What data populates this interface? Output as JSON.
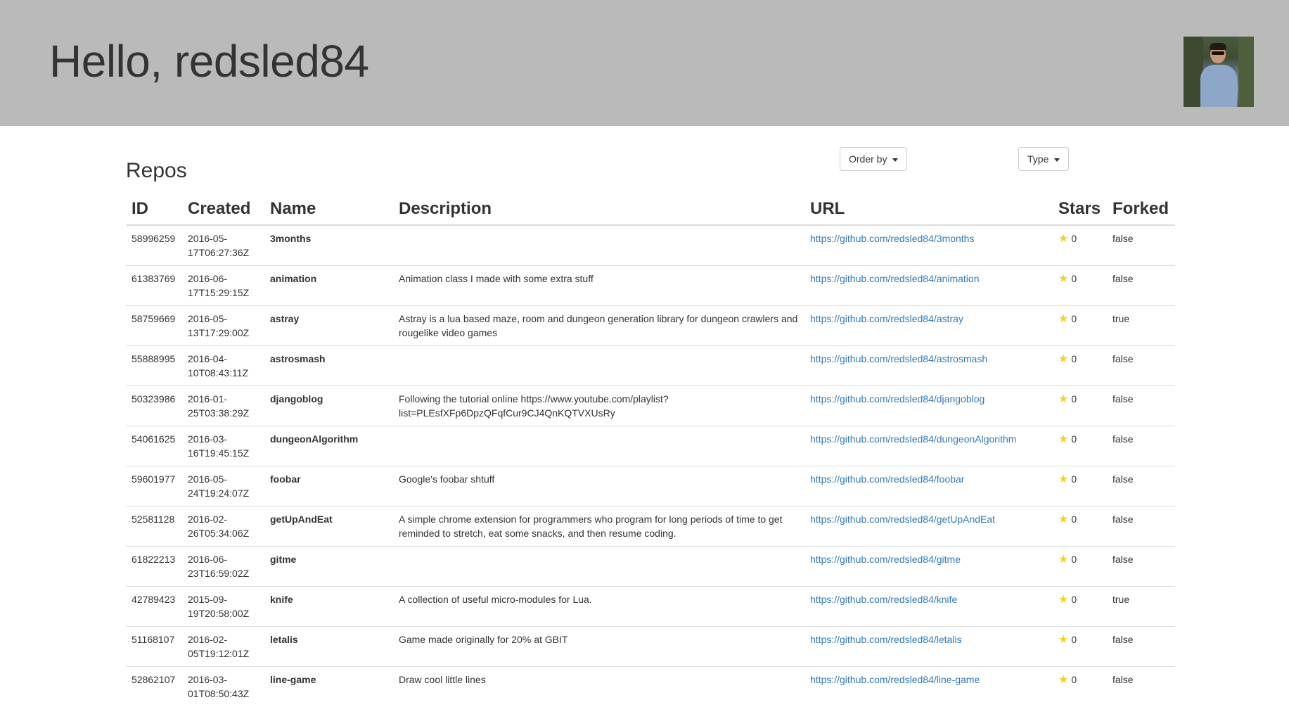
{
  "header": {
    "greeting": "Hello, redsled84"
  },
  "toolbar": {
    "order_by_label": "Order by",
    "type_label": "Type"
  },
  "section": {
    "title": "Repos"
  },
  "table": {
    "columns": [
      "ID",
      "Created",
      "Name",
      "Description",
      "URL",
      "Stars",
      "Forked"
    ],
    "rows": [
      {
        "id": "58996259",
        "created": "2016-05-17T06:27:36Z",
        "name": "3months",
        "description": "",
        "url": "https://github.com/redsled84/3months",
        "stars": "0",
        "forked": "false"
      },
      {
        "id": "61383769",
        "created": "2016-06-17T15:29:15Z",
        "name": "animation",
        "description": "Animation class I made with some extra stuff",
        "url": "https://github.com/redsled84/animation",
        "stars": "0",
        "forked": "false"
      },
      {
        "id": "58759669",
        "created": "2016-05-13T17:29:00Z",
        "name": "astray",
        "description": "Astray is a lua based maze, room and dungeon generation library for dungeon crawlers and rougelike video games",
        "url": "https://github.com/redsled84/astray",
        "stars": "0",
        "forked": "true"
      },
      {
        "id": "55888995",
        "created": "2016-04-10T08:43:11Z",
        "name": "astrosmash",
        "description": "",
        "url": "https://github.com/redsled84/astrosmash",
        "stars": "0",
        "forked": "false"
      },
      {
        "id": "50323986",
        "created": "2016-01-25T03:38:29Z",
        "name": "djangoblog",
        "description": "Following the tutorial online https://www.youtube.com/playlist?list=PLEsfXFp6DpzQFqfCur9CJ4QnKQTVXUsRy",
        "url": "https://github.com/redsled84/djangoblog",
        "stars": "0",
        "forked": "false"
      },
      {
        "id": "54061625",
        "created": "2016-03-16T19:45:15Z",
        "name": "dungeonAlgorithm",
        "description": "",
        "url": "https://github.com/redsled84/dungeonAlgorithm",
        "stars": "0",
        "forked": "false"
      },
      {
        "id": "59601977",
        "created": "2016-05-24T19:24:07Z",
        "name": "foobar",
        "description": "Google's foobar shtuff",
        "url": "https://github.com/redsled84/foobar",
        "stars": "0",
        "forked": "false"
      },
      {
        "id": "52581128",
        "created": "2016-02-26T05:34:06Z",
        "name": "getUpAndEat",
        "description": "A simple chrome extension for programmers who program for long periods of time to get reminded to stretch, eat some snacks, and then resume coding.",
        "url": "https://github.com/redsled84/getUpAndEat",
        "stars": "0",
        "forked": "false"
      },
      {
        "id": "61822213",
        "created": "2016-06-23T16:59:02Z",
        "name": "gitme",
        "description": "",
        "url": "https://github.com/redsled84/gitme",
        "stars": "0",
        "forked": "false"
      },
      {
        "id": "42789423",
        "created": "2015-09-19T20:58:00Z",
        "name": "knife",
        "description": "A collection of useful micro-modules for Lua.",
        "url": "https://github.com/redsled84/knife",
        "stars": "0",
        "forked": "true"
      },
      {
        "id": "51168107",
        "created": "2016-02-05T19:12:01Z",
        "name": "letalis",
        "description": "Game made originally for 20% at GBIT",
        "url": "https://github.com/redsled84/letalis",
        "stars": "0",
        "forked": "false"
      },
      {
        "id": "52862107",
        "created": "2016-03-01T08:50:43Z",
        "name": "line-game",
        "description": "Draw cool little lines",
        "url": "https://github.com/redsled84/line-game",
        "stars": "0",
        "forked": "false"
      }
    ]
  },
  "icons": {
    "star": "star-icon",
    "caret": "caret-down-icon"
  },
  "colors": {
    "header_bg": "#bababa",
    "link": "#337ab7",
    "star": "#f0d22a"
  }
}
